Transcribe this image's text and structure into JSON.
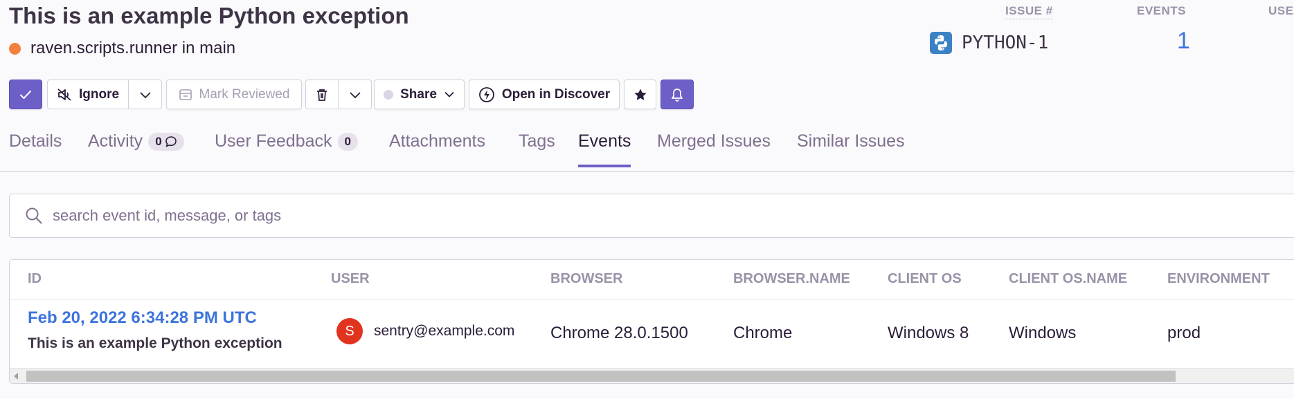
{
  "header": {
    "title": "This is an example Python exception",
    "culprit": "raven.scripts.runner in main",
    "level_color": "#f2813e",
    "stats": {
      "issue_label": "ISSUE #",
      "issue_id": "PYTHON-1",
      "platform_icon": "python-icon",
      "events_label": "EVENTS",
      "events_count": "1",
      "users_label": "USE"
    }
  },
  "actions": {
    "resolve_icon": "check-icon",
    "ignore_label": "Ignore",
    "mark_reviewed_label": "Mark Reviewed",
    "delete_icon": "trash-icon",
    "share_label": "Share",
    "open_discover_label": "Open in Discover",
    "bookmark_icon": "star-icon",
    "subscribe_icon": "bell-icon"
  },
  "tabs": [
    {
      "label": "Details"
    },
    {
      "label": "Activity",
      "badge": "0"
    },
    {
      "label": "User Feedback",
      "badge": "0"
    },
    {
      "label": "Attachments"
    },
    {
      "label": "Tags"
    },
    {
      "label": "Events",
      "active": true
    },
    {
      "label": "Merged Issues"
    },
    {
      "label": "Similar Issues"
    }
  ],
  "search": {
    "placeholder": "search event id, message, or tags",
    "value": ""
  },
  "table": {
    "columns": [
      "ID",
      "USER",
      "BROWSER",
      "BROWSER.NAME",
      "CLIENT OS",
      "CLIENT OS.NAME",
      "ENVIRONMENT"
    ],
    "rows": [
      {
        "timestamp": "Feb 20, 2022 6:34:28 PM UTC",
        "title": "This is an example Python exception",
        "avatar_letter": "S",
        "user": "sentry@example.com",
        "browser": "Chrome 28.0.1500",
        "browser_name": "Chrome",
        "client_os": "Windows 8",
        "client_os_name": "Windows",
        "environment": "prod"
      }
    ]
  },
  "colors": {
    "accent": "#6c5fc7",
    "link": "#3d74db",
    "avatar": "#e1331d"
  }
}
